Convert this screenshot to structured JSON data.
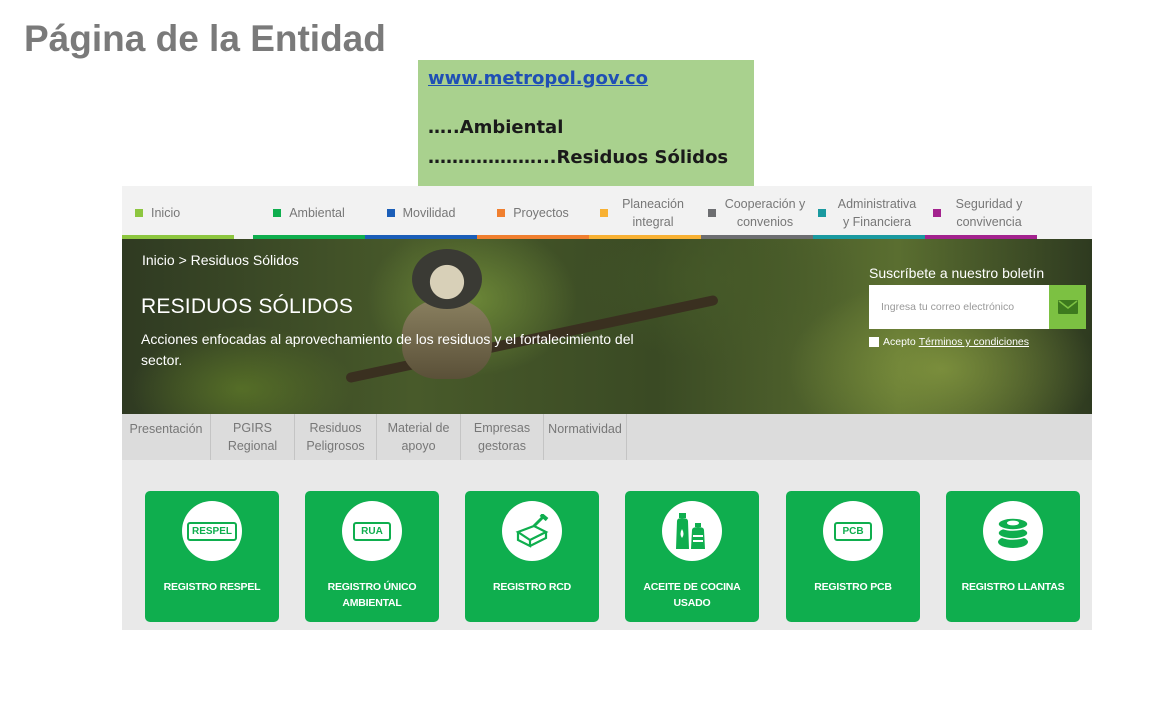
{
  "slide": {
    "title": "Página de la Entidad",
    "url": "www.metropol.gov.co",
    "path_line1": "…..Ambiental",
    "path_line2": "………………...Residuos Sólidos"
  },
  "nav": [
    {
      "label": "Inicio",
      "color": "#8dc63f"
    },
    {
      "label": "Ambiental",
      "color": "#0fae4e"
    },
    {
      "label": "Movilidad",
      "color": "#1b5eb8"
    },
    {
      "label": "Proyectos",
      "color": "#f07f2f"
    },
    {
      "label": "Planeación integral",
      "color": "#f8b133"
    },
    {
      "label": "Cooperación y convenios",
      "color": "#6d6e71"
    },
    {
      "label": "Administrativa y Financiera",
      "color": "#1a9aa0"
    },
    {
      "label": "Seguridad y convivencia",
      "color": "#a3238e"
    }
  ],
  "hero": {
    "breadcrumb": "Inicio > Residuos Sólidos",
    "title": "RESIDUOS SÓLIDOS",
    "description": "Acciones enfocadas al aprovechamiento de los residuos y el fortalecimiento del sector."
  },
  "newsletter": {
    "label": "Suscríbete a nuestro boletín",
    "placeholder": "Ingresa tu correo electrónico",
    "accept": "Acepto",
    "terms": "Términos y condiciones",
    "button_icon": "envelope-icon"
  },
  "tabs": [
    "Presentación",
    "PGIRS Regional",
    "Residuos Peligrosos",
    "Material de apoyo",
    "Empresas gestoras",
    "Normatividad"
  ],
  "cards": [
    {
      "label": "REGISTRO RESPEL",
      "icon": "respel-tag-icon",
      "tag": "RESPEL"
    },
    {
      "label": "REGISTRO ÚNICO AMBIENTAL",
      "icon": "rua-tag-icon",
      "tag": "RUA"
    },
    {
      "label": "REGISTRO RCD",
      "icon": "construction-debris-icon",
      "tag": ""
    },
    {
      "label": "ACEITE DE COCINA USADO",
      "icon": "oil-bottles-icon",
      "tag": ""
    },
    {
      "label": "REGISTRO PCB",
      "icon": "pcb-tag-icon",
      "tag": "PCB"
    },
    {
      "label": "REGISTRO LLANTAS",
      "icon": "tires-icon",
      "tag": ""
    }
  ],
  "colors": {
    "brand_green": "#0fae4e",
    "note_bg": "#a9d18e",
    "send_button": "#7cc142"
  }
}
